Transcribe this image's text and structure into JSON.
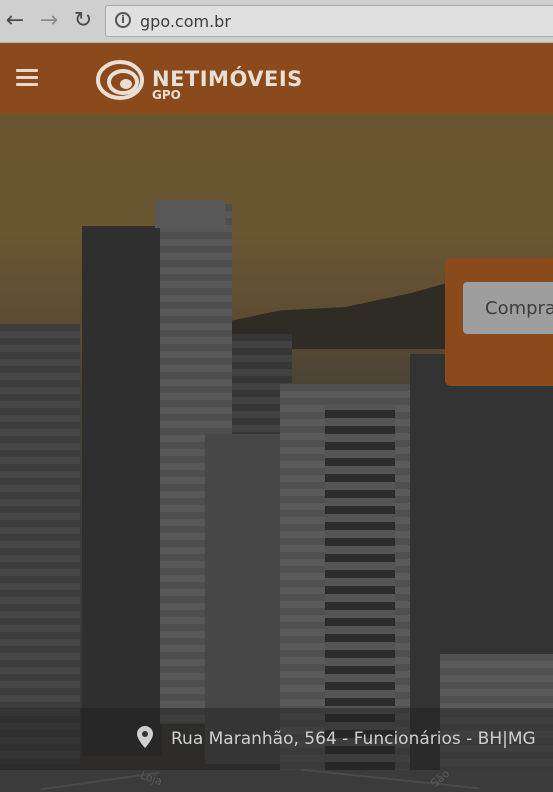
{
  "browser": {
    "back_icon": "←",
    "forward_icon": "→",
    "reload_icon": "↻",
    "info_icon": "i",
    "url": "gpo.com.br"
  },
  "header": {
    "brand": "NETIMÓVEIS",
    "brand_sub": "GPO"
  },
  "search": {
    "selected_option": "Compra"
  },
  "footer": {
    "address": "Rua Maranhão, 564 - Funcionários - BH|MG"
  },
  "map": {
    "labels": [
      "Loja",
      "São"
    ]
  }
}
